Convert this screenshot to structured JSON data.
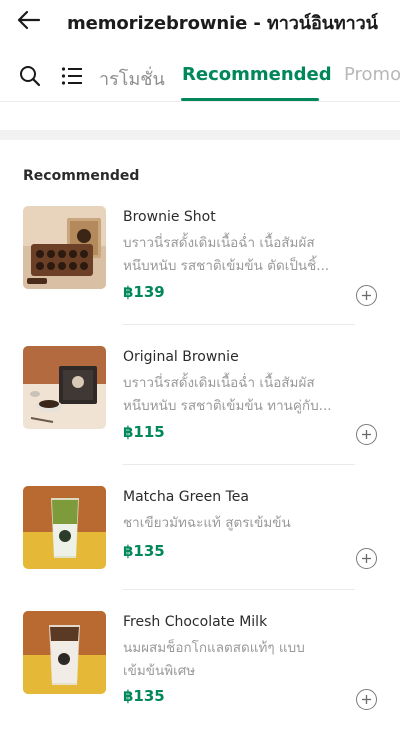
{
  "header": {
    "store_title": "memorizebrownie - ทาวน์อินทาวน์"
  },
  "tabs": {
    "items": [
      {
        "label": "โปรโมชั่น",
        "visible_text": "ารโมชั่น"
      },
      {
        "label": "Recommended"
      },
      {
        "label": "Promo"
      }
    ],
    "active": "Recommended"
  },
  "section": {
    "title": "Recommended"
  },
  "products": [
    {
      "name": "Brownie Shot",
      "desc_lines": [
        "บราวนี่รสดั้งเดิมเนื้อฉ่ำ เนื้อสัมผัส",
        "หนึบหนับ รสชาติเข้มข้น ตัดเป็นชิ้..."
      ],
      "price": "฿139"
    },
    {
      "name": "Original Brownie",
      "desc_lines": [
        "บราวนี่รสดั้งเดิมเนื้อฉ่ำ เนื้อสัมผัส",
        "หนึบหนับ รสชาติเข้มข้น ทานคู่กับ..."
      ],
      "price": "฿115"
    },
    {
      "name": "Matcha Green Tea",
      "desc_lines": [
        "ชาเขียวมัทฉะแท้ สูตรเข้มข้น"
      ],
      "price": "฿135"
    },
    {
      "name": "Fresh Chocolate Milk",
      "desc_lines": [
        "นมผสมช็อกโกแลตสดแท้ๆ แบบ",
        "เข้มข้นพิเศษ"
      ],
      "price": "฿135"
    }
  ],
  "colors": {
    "accent": "#00875a",
    "text_primary": "#2b2b2b",
    "text_secondary": "#9a9a9a"
  }
}
